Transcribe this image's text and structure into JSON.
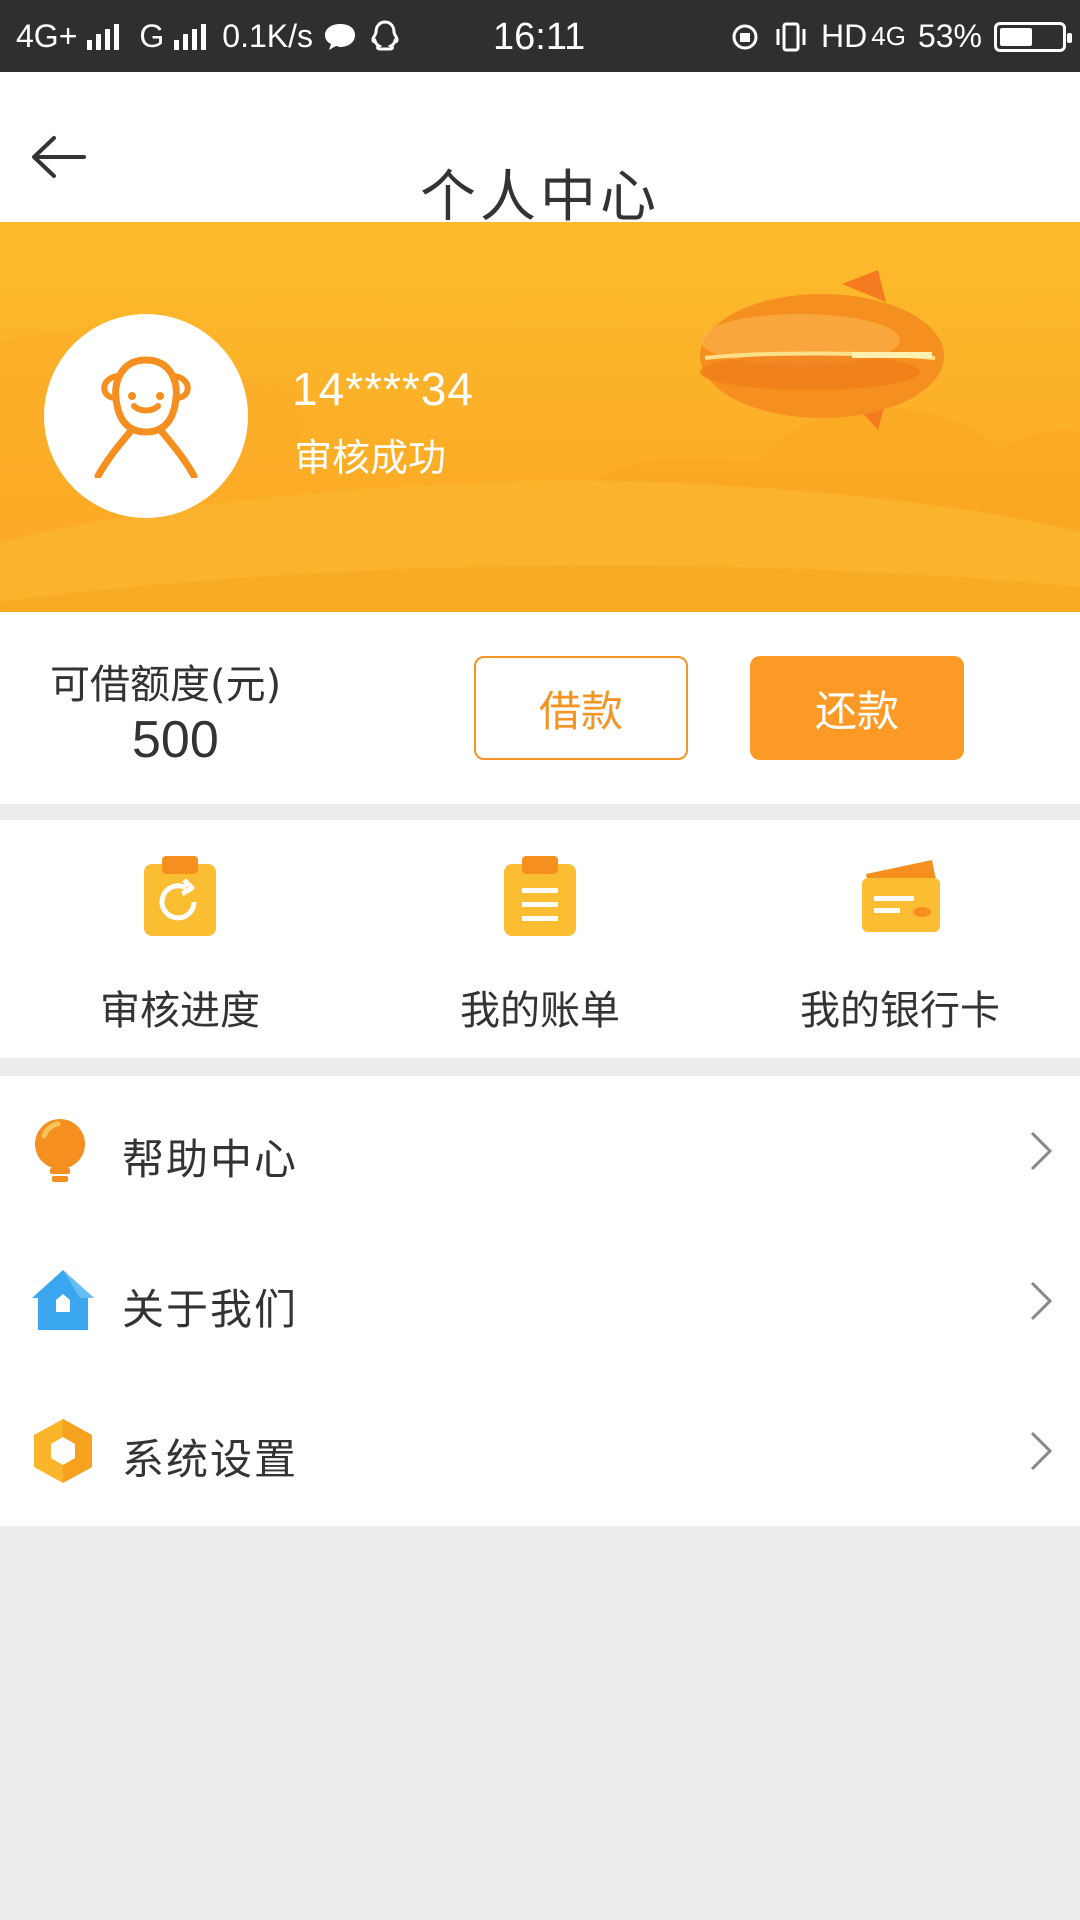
{
  "status_bar": {
    "network_left": "4G+",
    "network_g": "G",
    "speed": "0.1K/s",
    "time": "16:11",
    "hd": "HD",
    "network_right": "4G",
    "battery": "53%",
    "battery_level": 0.53
  },
  "header": {
    "title": "个人中心"
  },
  "profile": {
    "phone": "14****34",
    "status": "审核成功"
  },
  "credit": {
    "label": "可借额度(元)",
    "value": "500",
    "borrow_label": "借款",
    "repay_label": "还款"
  },
  "shortcuts": [
    {
      "label": "审核进度",
      "icon": "review-progress-icon"
    },
    {
      "label": "我的账单",
      "icon": "bill-icon"
    },
    {
      "label": "我的银行卡",
      "icon": "bank-card-icon"
    }
  ],
  "menu": [
    {
      "label": "帮助中心",
      "icon": "lightbulb-icon"
    },
    {
      "label": "关于我们",
      "icon": "home-icon"
    },
    {
      "label": "系统设置",
      "icon": "settings-hexagon-icon"
    }
  ],
  "colors": {
    "accent": "#fd9a26",
    "banner": "#fdb72b",
    "status_bar": "#2f2f2f",
    "background": "#ececec"
  }
}
